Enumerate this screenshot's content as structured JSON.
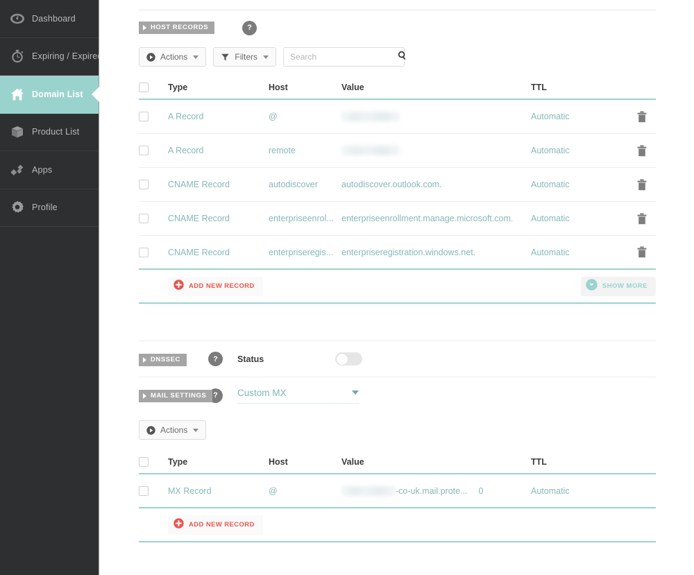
{
  "sidebar": {
    "items": [
      {
        "label": "Dashboard",
        "icon": "dashboard-gauge-icon",
        "active": false
      },
      {
        "label": "Expiring / Expired",
        "icon": "stopwatch-icon",
        "active": false
      },
      {
        "label": "Domain List",
        "icon": "house-icon",
        "active": true
      },
      {
        "label": "Product List",
        "icon": "box-icon",
        "active": false
      },
      {
        "label": "Apps",
        "icon": "diamonds-icon",
        "active": false
      },
      {
        "label": "Profile",
        "icon": "gear-icon",
        "active": false
      }
    ]
  },
  "host_records": {
    "section_label": "HOST RECORDS",
    "help_label": "?",
    "toolbar": {
      "actions_label": "Actions",
      "filters_label": "Filters",
      "search_placeholder": "Search",
      "search_value": ""
    },
    "columns": [
      "Type",
      "Host",
      "Value",
      "TTL"
    ],
    "rows": [
      {
        "type": "A Record",
        "host": "@",
        "value": "",
        "value_redacted": true,
        "redact_width": 84,
        "ttl": "Automatic"
      },
      {
        "type": "A Record",
        "host": "remote",
        "value": "",
        "value_redacted": true,
        "redact_width": 84,
        "ttl": "Automatic"
      },
      {
        "type": "CNAME Record",
        "host": "autodiscover",
        "value": "autodiscover.outlook.com.",
        "value_redacted": false,
        "redact_width": 0,
        "ttl": "Automatic"
      },
      {
        "type": "CNAME Record",
        "host": "enterpriseenrol...",
        "value": "enterpriseenrollment.manage.microsoft.com.",
        "value_redacted": false,
        "redact_width": 0,
        "ttl": "Automatic"
      },
      {
        "type": "CNAME Record",
        "host": "enterpriseregis...",
        "value": "enterpriseregistration.windows.net.",
        "value_redacted": false,
        "redact_width": 0,
        "ttl": "Automatic"
      }
    ],
    "add_label": "ADD NEW RECORD",
    "show_more_label": "SHOW MORE"
  },
  "dnssec": {
    "section_label": "DNSSEC",
    "help_label": "?",
    "status_label": "Status",
    "status_on": false
  },
  "mail_settings": {
    "section_label": "MAIL SETTINGS",
    "help_label": "?",
    "selected_option": "Custom MX",
    "actions_label": "Actions",
    "columns": [
      "Type",
      "Host",
      "Value",
      "TTL"
    ],
    "rows": [
      {
        "type": "MX Record",
        "host": "@",
        "value_suffix": "-co-uk.mail.prote...",
        "value_redacted": true,
        "redact_width": 78,
        "priority": "0",
        "ttl": "Automatic"
      }
    ],
    "add_label": "ADD NEW RECORD"
  },
  "colors": {
    "sidebar_bg": "#2e2f31",
    "accent_teal": "#9ad3ce",
    "text_teal": "#85b9b6",
    "add_red": "#e8544f",
    "tag_gray": "#a5a5a5"
  }
}
